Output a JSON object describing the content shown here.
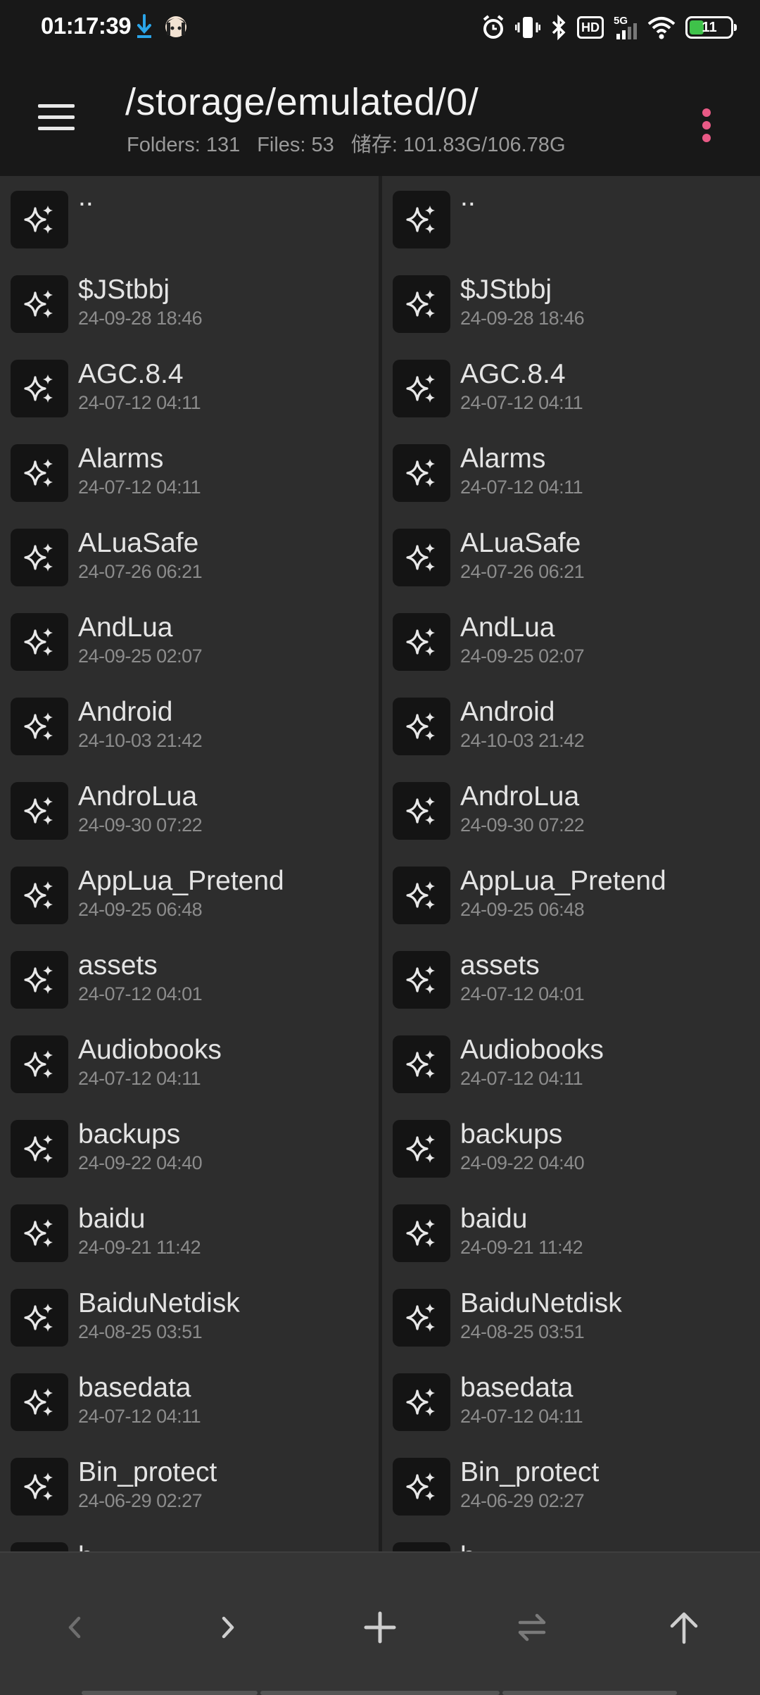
{
  "status_bar": {
    "time": "01:17:39",
    "battery": "11"
  },
  "header": {
    "path": "/storage/emulated/0/",
    "folders": "Folders: 131",
    "files": "Files: 53",
    "storage": "储存: 101.83G/106.78G"
  },
  "left_pane": {
    "items": [
      {
        "name": "..",
        "date": ""
      },
      {
        "name": "$JStbbj",
        "date": "24-09-28 18:46"
      },
      {
        "name": "AGC.8.4",
        "date": "24-07-12 04:11"
      },
      {
        "name": "Alarms",
        "date": "24-07-12 04:11"
      },
      {
        "name": "ALuaSafe",
        "date": "24-07-26 06:21"
      },
      {
        "name": "AndLua",
        "date": "24-09-25 02:07"
      },
      {
        "name": "Android",
        "date": "24-10-03 21:42"
      },
      {
        "name": "AndroLua",
        "date": "24-09-30 07:22"
      },
      {
        "name": "AppLua_Pretend",
        "date": "24-09-25 06:48"
      },
      {
        "name": "assets",
        "date": "24-07-12 04:01"
      },
      {
        "name": "Audiobooks",
        "date": "24-07-12 04:11"
      },
      {
        "name": "backups",
        "date": "24-09-22 04:40"
      },
      {
        "name": "baidu",
        "date": "24-09-21 11:42"
      },
      {
        "name": "BaiduNetdisk",
        "date": "24-08-25 03:51"
      },
      {
        "name": "basedata",
        "date": "24-07-12 04:11"
      },
      {
        "name": "Bin_protect",
        "date": "24-06-29 02:27"
      },
      {
        "name": "b",
        "date": ""
      }
    ]
  },
  "right_pane": {
    "items": [
      {
        "name": "..",
        "date": ""
      },
      {
        "name": "$JStbbj",
        "date": "24-09-28 18:46"
      },
      {
        "name": "AGC.8.4",
        "date": "24-07-12 04:11"
      },
      {
        "name": "Alarms",
        "date": "24-07-12 04:11"
      },
      {
        "name": "ALuaSafe",
        "date": "24-07-26 06:21"
      },
      {
        "name": "AndLua",
        "date": "24-09-25 02:07"
      },
      {
        "name": "Android",
        "date": "24-10-03 21:42"
      },
      {
        "name": "AndroLua",
        "date": "24-09-30 07:22"
      },
      {
        "name": "AppLua_Pretend",
        "date": "24-09-25 06:48"
      },
      {
        "name": "assets",
        "date": "24-07-12 04:01"
      },
      {
        "name": "Audiobooks",
        "date": "24-07-12 04:11"
      },
      {
        "name": "backups",
        "date": "24-09-22 04:40"
      },
      {
        "name": "baidu",
        "date": "24-09-21 11:42"
      },
      {
        "name": "BaiduNetdisk",
        "date": "24-08-25 03:51"
      },
      {
        "name": "basedata",
        "date": "24-07-12 04:11"
      },
      {
        "name": "Bin_protect",
        "date": "24-06-29 02:27"
      },
      {
        "name": "b",
        "date": ""
      }
    ]
  },
  "icons": {
    "folder_item": "sparkle-icon",
    "menu": "hamburger-menu-icon",
    "more": "vertical-dots-icon",
    "back": "chevron-left-icon",
    "forward": "chevron-right-icon",
    "add": "plus-icon",
    "swap": "swap-arrows-icon",
    "up": "arrow-up-icon"
  },
  "colors": {
    "accent": "#e95a86",
    "background": "#2d2d2d",
    "header": "#181818",
    "battery": "#3fc24a"
  }
}
